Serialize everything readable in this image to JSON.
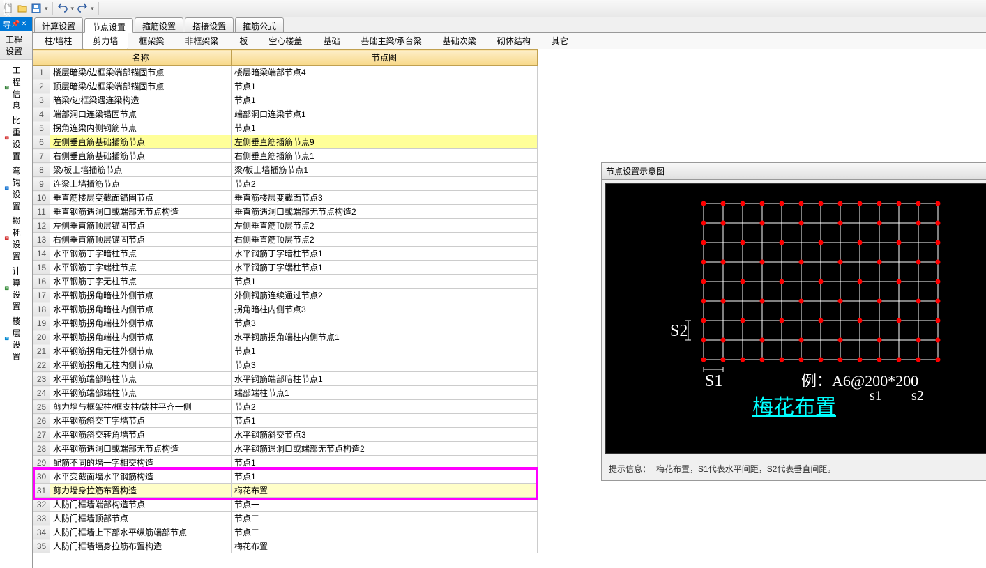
{
  "toolbar": {
    "icons": [
      "new",
      "open",
      "save",
      "sep",
      "undo",
      "redo",
      "sep"
    ]
  },
  "nav": {
    "title": "模块导航栏",
    "subtitle": "工程设置",
    "items": [
      {
        "icon": "#2e7d32",
        "label": "工程信息"
      },
      {
        "icon": "#d32f2f",
        "label": "比重设置"
      },
      {
        "icon": "#1976d2",
        "label": "弯钩设置"
      },
      {
        "icon": "#d32f2f",
        "label": "损耗设置"
      },
      {
        "icon": "#388e3c",
        "label": "计算设置"
      },
      {
        "icon": "#0288d1",
        "label": "楼层设置"
      }
    ]
  },
  "tabs": [
    "计算设置",
    "节点设置",
    "箍筋设置",
    "搭接设置",
    "箍筋公式"
  ],
  "active_tab": 1,
  "subtabs": [
    "柱/墙柱",
    "剪力墙",
    "框架梁",
    "非框架梁",
    "板",
    "空心楼盖",
    "基础",
    "基础主梁/承台梁",
    "基础次梁",
    "砌体结构",
    "其它"
  ],
  "active_subtab": 1,
  "table": {
    "headers": [
      "",
      "名称",
      "节点图"
    ],
    "rows": [
      {
        "n": 1,
        "name": "楼层暗梁/边框梁端部锚固节点",
        "node": "楼层暗梁端部节点4"
      },
      {
        "n": 2,
        "name": "顶层暗梁/边框梁端部锚固节点",
        "node": "节点1"
      },
      {
        "n": 3,
        "name": "暗梁/边框梁遇连梁构造",
        "node": "节点1"
      },
      {
        "n": 4,
        "name": "端部洞口连梁锚固节点",
        "node": "端部洞口连梁节点1"
      },
      {
        "n": 5,
        "name": "拐角连梁内侧钢筋节点",
        "node": "节点1"
      },
      {
        "n": 6,
        "name": "左侧垂直筋基础插筋节点",
        "node": "左侧垂直筋插筋节点9",
        "hl": true
      },
      {
        "n": 7,
        "name": "右侧垂直筋基础插筋节点",
        "node": "右侧垂直筋插筋节点1"
      },
      {
        "n": 8,
        "name": "梁/板上墙插筋节点",
        "node": "梁/板上墙插筋节点1"
      },
      {
        "n": 9,
        "name": "连梁上墙插筋节点",
        "node": "节点2"
      },
      {
        "n": 10,
        "name": "垂直筋楼层变截面锚固节点",
        "node": "垂直筋楼层变截面节点3"
      },
      {
        "n": 11,
        "name": "垂直钢筋遇洞口或端部无节点构造",
        "node": "垂直筋遇洞口或端部无节点构造2"
      },
      {
        "n": 12,
        "name": "左侧垂直筋顶层锚固节点",
        "node": "左侧垂直筋顶层节点2"
      },
      {
        "n": 13,
        "name": "右侧垂直筋顶层锚固节点",
        "node": "右侧垂直筋顶层节点2"
      },
      {
        "n": 14,
        "name": "水平钢筋丁字暗柱节点",
        "node": "水平钢筋丁字暗柱节点1"
      },
      {
        "n": 15,
        "name": "水平钢筋丁字端柱节点",
        "node": "水平钢筋丁字端柱节点1"
      },
      {
        "n": 16,
        "name": "水平钢筋丁字无柱节点",
        "node": "节点1"
      },
      {
        "n": 17,
        "name": "水平钢筋拐角暗柱外侧节点",
        "node": "外侧钢筋连续通过节点2"
      },
      {
        "n": 18,
        "name": "水平钢筋拐角暗柱内侧节点",
        "node": "拐角暗柱内侧节点3"
      },
      {
        "n": 19,
        "name": "水平钢筋拐角端柱外侧节点",
        "node": "节点3"
      },
      {
        "n": 20,
        "name": "水平钢筋拐角端柱内侧节点",
        "node": "水平钢筋拐角端柱内侧节点1"
      },
      {
        "n": 21,
        "name": "水平钢筋拐角无柱外侧节点",
        "node": "节点1"
      },
      {
        "n": 22,
        "name": "水平钢筋拐角无柱内侧节点",
        "node": "节点3"
      },
      {
        "n": 23,
        "name": "水平钢筋端部暗柱节点",
        "node": "水平钢筋端部暗柱节点1"
      },
      {
        "n": 24,
        "name": "水平钢筋端部端柱节点",
        "node": "端部端柱节点1"
      },
      {
        "n": 25,
        "name": "剪力墙与框架柱/框支柱/端柱平齐一侧",
        "node": "节点2"
      },
      {
        "n": 26,
        "name": "水平钢筋斜交丁字墙节点",
        "node": "节点1"
      },
      {
        "n": 27,
        "name": "水平钢筋斜交转角墙节点",
        "node": "水平钢筋斜交节点3"
      },
      {
        "n": 28,
        "name": "水平钢筋遇洞口或端部无节点构造",
        "node": "水平钢筋遇洞口或端部无节点构造2"
      },
      {
        "n": 29,
        "name": "配筋不同的墙一字相交构造",
        "node": "节点1"
      },
      {
        "n": 30,
        "name": "水平变截面墙水平钢筋构造",
        "node": "节点1"
      },
      {
        "n": 31,
        "name": "剪力墙身拉筋布置构造",
        "node": "梅花布置",
        "sel": true
      },
      {
        "n": 32,
        "name": "人防门框墙端部构造节点",
        "node": "节点一"
      },
      {
        "n": 33,
        "name": "人防门框墙顶部节点",
        "node": "节点二"
      },
      {
        "n": 34,
        "name": "人防门框墙上下部水平纵筋端部节点",
        "node": "节点二"
      },
      {
        "n": 35,
        "name": "人防门框墙墙身拉筋布置构造",
        "node": "梅花布置"
      }
    ]
  },
  "diagram": {
    "title": "节点设置示意图",
    "s1": "S1",
    "s2": "S2",
    "example": "例：A6@200*200",
    "sub1": "s1",
    "sub2": "s2",
    "layout_name": "梅花布置",
    "hint_label": "提示信息：",
    "hint_text": "梅花布置，S1代表水平间距，S2代表垂直间距。"
  }
}
